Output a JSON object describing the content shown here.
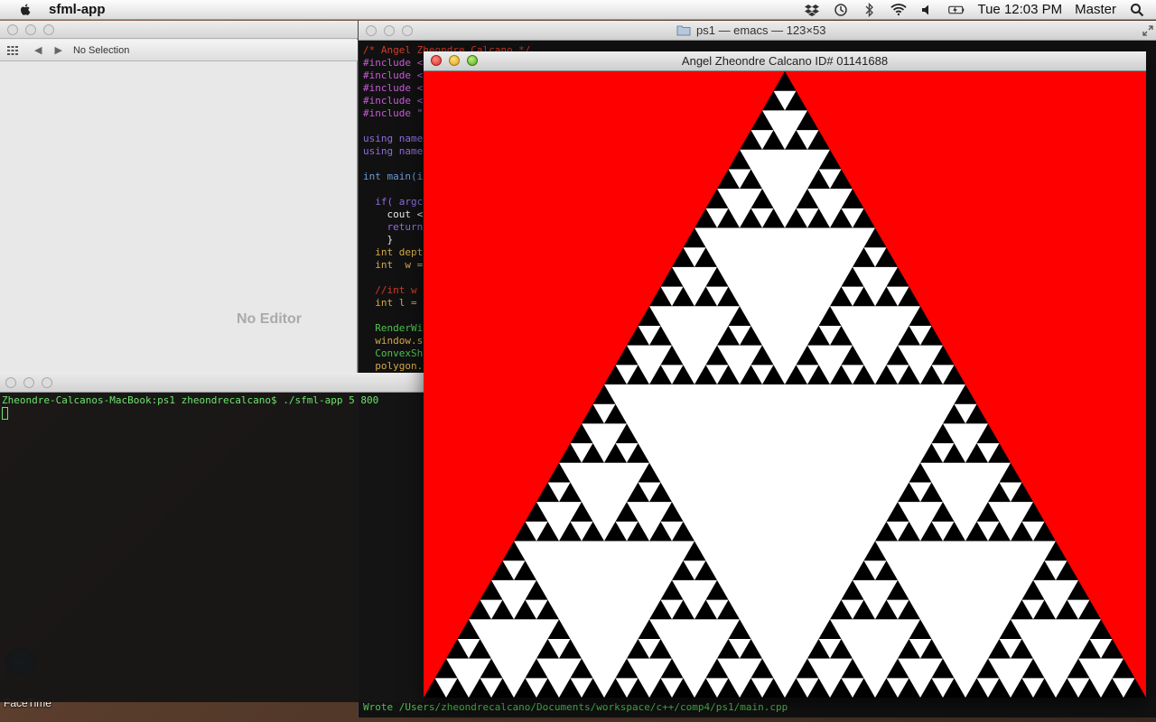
{
  "menubar": {
    "apple_icon": "apple-icon",
    "app_name": "sfml-app",
    "status_icons": [
      "dropbox-icon",
      "time-machine-icon",
      "bluetooth-icon",
      "wifi-icon",
      "volume-icon",
      "battery-icon"
    ],
    "clock": "Tue 12:03 PM",
    "user": "Master",
    "search_icon": "spotlight-search-icon"
  },
  "xcode": {
    "jumpbar_selection": "No Selection",
    "placeholder": "No Editor"
  },
  "emacs": {
    "title": "ps1 — emacs — 123×53",
    "code_lines": [
      {
        "cls": "c-comment",
        "text": "/* Angel Zheondre Calcano */"
      },
      {
        "cls": "c-pre",
        "text": "#include <"
      },
      {
        "cls": "c-pre",
        "text": "#include <"
      },
      {
        "cls": "c-pre",
        "text": "#include <"
      },
      {
        "cls": "c-pre",
        "text": "#include <"
      },
      {
        "cls": "c-pre",
        "text": "#include \""
      },
      {
        "cls": "c-plain",
        "text": ""
      },
      {
        "cls": "c-kw",
        "text": "using name"
      },
      {
        "cls": "c-kw",
        "text": "using name"
      },
      {
        "cls": "c-plain",
        "text": ""
      },
      {
        "cls": "c-type",
        "text": "int main(i"
      },
      {
        "cls": "c-plain",
        "text": ""
      },
      {
        "cls": "c-kw",
        "text": "  if( argc"
      },
      {
        "cls": "c-plain",
        "text": "    cout <"
      },
      {
        "cls": "c-kw",
        "text": "    return"
      },
      {
        "cls": "c-plain",
        "text": "    }"
      },
      {
        "cls": "c-var",
        "text": "  int dept"
      },
      {
        "cls": "c-var",
        "text": "  int  w ="
      },
      {
        "cls": "c-plain",
        "text": ""
      },
      {
        "cls": "c-comment",
        "text": "  //int w"
      },
      {
        "cls": "c-var",
        "text": "  int l ="
      },
      {
        "cls": "c-plain",
        "text": ""
      },
      {
        "cls": "c-fn",
        "text": "  RenderWi"
      },
      {
        "cls": "c-var",
        "text": "  window.s"
      },
      {
        "cls": "c-fn",
        "text": "  ConvexSh"
      },
      {
        "cls": "c-var",
        "text": "  polygon."
      }
    ],
    "status_line": "Wrote /Users/zheondrecalcano/Documents/workspace/c++/comp4/ps1/main.cpp"
  },
  "terminal": {
    "prompt": "Zheondre-Calcanos-MacBook:ps1 zheondrecalcano$ ./sfml-app 5 800"
  },
  "sfml": {
    "title": "Angel Zheondre Calcano ID# 01141688",
    "background_color": "#ff0000",
    "fractal_fill_color": "#000000",
    "fractal_hole_color": "#ffffff",
    "depth": 5
  },
  "dock": {
    "facetime_label": "FaceTime"
  }
}
